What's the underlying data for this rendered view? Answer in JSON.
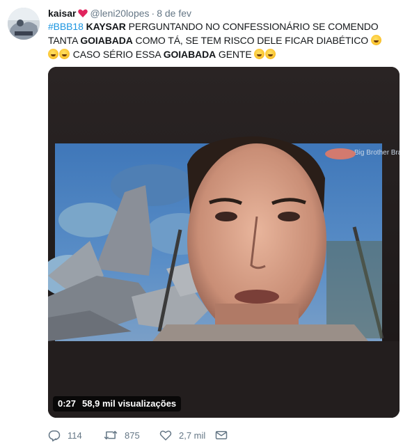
{
  "tweet": {
    "display_name": "kaisar",
    "handle": "@leni20lopes",
    "separator": "·",
    "date": "8 de fev",
    "text": {
      "hashtag": "#BBB18",
      "name_bold": "KAYSAR",
      "part1": " PERGUNTANDO NO CONFESSIONÁRIO SE COMENDO TANTA ",
      "bold1": "GOIABADA",
      "part2": " COMO TÁ, SE TEM RISCO DELE FICAR DIABÉTICO ",
      "part3": " CASO SÉRIO ESSA ",
      "bold2": "GOIABADA",
      "part4": " GENTE "
    },
    "emoji_name": "rolling-on-floor-laughing-emoji"
  },
  "video": {
    "duration": "0:27",
    "views": "58,9 mil visualizações",
    "watermark": "Big Brother Brasil"
  },
  "actions": {
    "replies": "114",
    "retweets": "875",
    "likes": "2,7 mil"
  },
  "colors": {
    "link": "#1b95e0",
    "muted": "#657786",
    "heart": "#e0245e"
  }
}
